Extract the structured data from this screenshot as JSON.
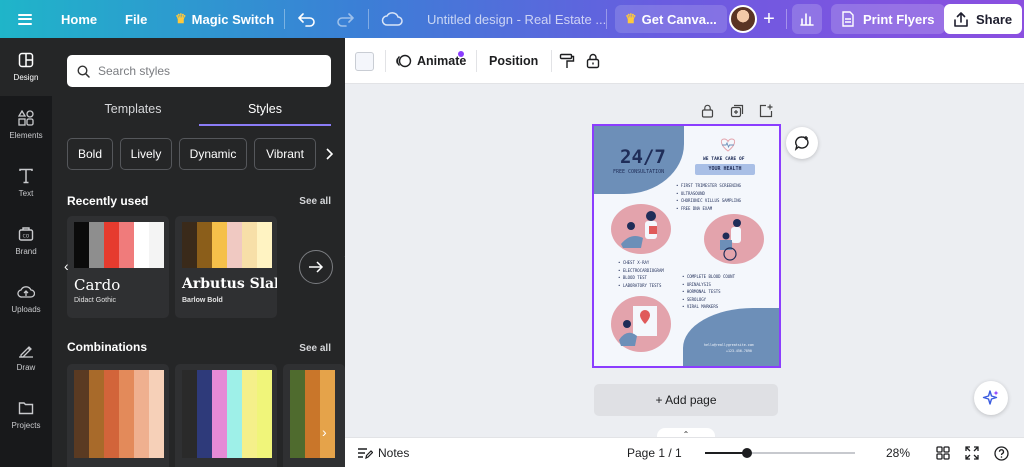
{
  "topbar": {
    "home": "Home",
    "file": "File",
    "magic_switch": "Magic Switch",
    "doc_title": "Untitled design - Real Estate ...",
    "get_canva": "Get Canva...",
    "print_flyers": "Print Flyers",
    "share": "Share",
    "colors": {
      "gradient_start": "#1fb5c9",
      "gradient_end": "#8b4fe0",
      "crown": "#ffc93c"
    }
  },
  "rail": {
    "items": [
      {
        "label": "Design",
        "icon": "design-icon",
        "active": true
      },
      {
        "label": "Elements",
        "icon": "elements-icon"
      },
      {
        "label": "Text",
        "icon": "text-icon"
      },
      {
        "label": "Brand",
        "icon": "brand-icon"
      },
      {
        "label": "Uploads",
        "icon": "uploads-icon"
      },
      {
        "label": "Draw",
        "icon": "draw-icon"
      },
      {
        "label": "Projects",
        "icon": "projects-icon"
      }
    ]
  },
  "panel": {
    "search_placeholder": "Search styles",
    "tabs": [
      {
        "label": "Templates"
      },
      {
        "label": "Styles",
        "active": true
      }
    ],
    "chips": [
      "Bold",
      "Lively",
      "Dynamic",
      "Vibrant"
    ],
    "recently_used": {
      "title": "Recently used",
      "see_all": "See all",
      "cards": [
        {
          "title": "Cardo",
          "subtitle": "Didact Gothic",
          "swatches": [
            "#0b0b0b",
            "#8e8e8e",
            "#e63b2e",
            "#f07b7b",
            "#ffffff",
            "#f4f4f4"
          ]
        },
        {
          "title": "Arbutus Slab",
          "subtitle": "Barlow Bold",
          "swatches": [
            "#3a2a1a",
            "#8b5e1a",
            "#f5c04a",
            "#f0c9c2",
            "#f7dfa8",
            "#fff3c2"
          ]
        }
      ]
    },
    "combinations": {
      "title": "Combinations",
      "see_all": "See all",
      "cards": [
        {
          "swatches": [
            "#5a3a22",
            "#a86a2a",
            "#d2643a",
            "#e38a5a",
            "#efb08f",
            "#f6d0b8"
          ]
        },
        {
          "swatches": [
            "#2a2a2a",
            "#2e3a7a",
            "#e58ad6",
            "#9ef0e8",
            "#f5f08a",
            "#f0f57a"
          ]
        },
        {
          "swatches": [
            "#4f6b2e",
            "#c9762a",
            "#e5a34a"
          ]
        }
      ]
    },
    "colors": {
      "panel_bg": "#252627",
      "rail_bg": "#18191b",
      "tab_underline": "#8b7cf6"
    }
  },
  "editor_toolbar": {
    "animate": "Animate",
    "position": "Position"
  },
  "flyer": {
    "headline": "24/7",
    "sub_headline": "FREE CONSULTATION",
    "tagline": "WE TAKE CARE OF",
    "tag_pill": "YOUR HEALTH",
    "list1": [
      "FIRST TRIMESTER SCREENING",
      "ULTRASOUND",
      "CHORIONIC VILLUS SAMPLING",
      "FREE DNA EXAM"
    ],
    "list2": [
      "CHEST X-RAY",
      "ELECTROCARDIOGRAM",
      "BLOOD TEST",
      "LABORATORY TESTS"
    ],
    "list3": [
      "COMPLETE BLOOD COUNT",
      "URINALYSIS",
      "HORMONAL TESTS",
      "SEROLOGY",
      "VIRAL MARKERS"
    ],
    "contact_email": "hello@reallygreatsite.com",
    "contact_phone": "+123-456-7890",
    "colors": {
      "blue": "#6d8fb8",
      "pink": "#e3a3ac",
      "navy": "#1f2d58",
      "selection": "#8b3dff"
    }
  },
  "canvas": {
    "add_page": "+ Add page"
  },
  "bottombar": {
    "notes": "Notes",
    "page_indicator": "Page 1 / 1",
    "zoom": "28%",
    "zoom_fraction": 0.28
  }
}
